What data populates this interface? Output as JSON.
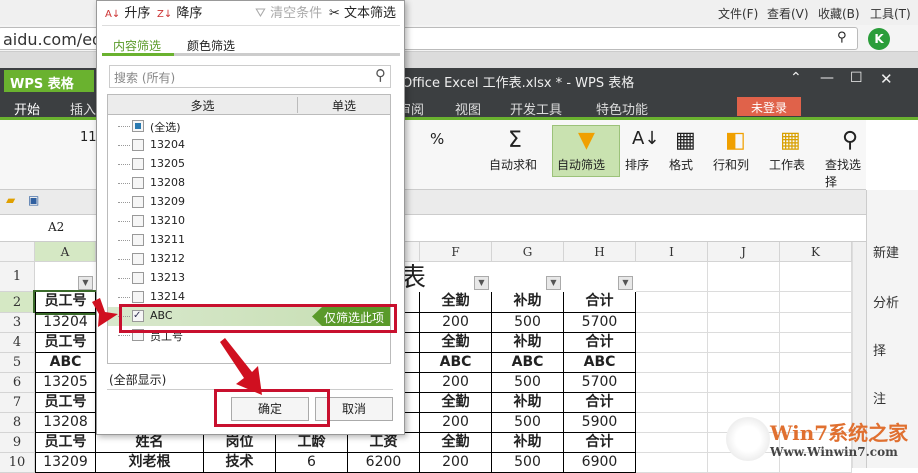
{
  "browser": {
    "address": "aidu.com/edi",
    "menu": [
      "文件(F)",
      "查看(V)",
      "收藏(B)",
      "工具(T)"
    ]
  },
  "wps": {
    "logo": "WPS 表格",
    "title": "Office Excel 工作表.xlsx * - WPS 表格",
    "tabs": [
      "开始",
      "插入",
      "审阅",
      "视图",
      "开发工具",
      "特色功能"
    ],
    "login": "未登录",
    "font_size": "11",
    "ribbon": [
      "自动求和",
      "自动筛选",
      "排序",
      "格式",
      "行和列",
      "工作表",
      "查找选择"
    ],
    "cell_ref": "A2",
    "side_panel": [
      "新建",
      "分析",
      "择",
      "注"
    ]
  },
  "popup": {
    "sort_asc": "升序",
    "sort_desc": "降序",
    "clear": "清空条件",
    "text_filter": "文本筛选",
    "tabs": [
      "内容筛选",
      "颜色筛选"
    ],
    "search_placeholder": "搜索 (所有)",
    "col_multi": "多选",
    "col_single": "单选",
    "items": [
      {
        "label": "(全选)",
        "state": "partial"
      },
      {
        "label": "13204",
        "state": "off"
      },
      {
        "label": "13205",
        "state": "off"
      },
      {
        "label": "13208",
        "state": "off"
      },
      {
        "label": "13209",
        "state": "off"
      },
      {
        "label": "13210",
        "state": "off"
      },
      {
        "label": "13211",
        "state": "off"
      },
      {
        "label": "13212",
        "state": "off"
      },
      {
        "label": "13213",
        "state": "off"
      },
      {
        "label": "13214",
        "state": "off"
      },
      {
        "label": "ABC",
        "state": "on"
      },
      {
        "label": "员工号",
        "state": "off"
      }
    ],
    "only_this": "仅筛选此项",
    "show_all": "(全部显示)",
    "ok": "确定",
    "cancel": "取消"
  },
  "sheet": {
    "columns": [
      "A",
      "B",
      "C",
      "D",
      "E",
      "F",
      "G",
      "H",
      "I",
      "J",
      "K"
    ],
    "title_fragment": "表",
    "rows": [
      [
        "",
        "",
        "",
        "",
        "",
        "",
        "",
        ""
      ],
      [
        "员工号",
        "",
        "",
        "",
        "",
        "全勤",
        "补助",
        "合计"
      ],
      [
        "13204",
        "",
        "",
        "",
        "",
        "200",
        "500",
        "5700"
      ],
      [
        "员工号",
        "",
        "",
        "",
        "",
        "全勤",
        "补助",
        "合计"
      ],
      [
        "ABC",
        "",
        "",
        "",
        "",
        "ABC",
        "ABC",
        "ABC"
      ],
      [
        "13205",
        "",
        "",
        "",
        "",
        "200",
        "500",
        "5700"
      ],
      [
        "员工号",
        "",
        "",
        "",
        "",
        "全勤",
        "补助",
        "合计"
      ],
      [
        "13208",
        "",
        "",
        "",
        "",
        "200",
        "500",
        "5900"
      ],
      [
        "员工号",
        "姓名",
        "岗位",
        "工龄",
        "工资",
        "全勤",
        "补助",
        "合计"
      ],
      [
        "13209",
        "刘老根",
        "技术",
        "6",
        "6200",
        "200",
        "500",
        "6900"
      ]
    ]
  },
  "watermark": {
    "brand": "Win7系统之家",
    "url": "Www.Winwin7.com"
  }
}
